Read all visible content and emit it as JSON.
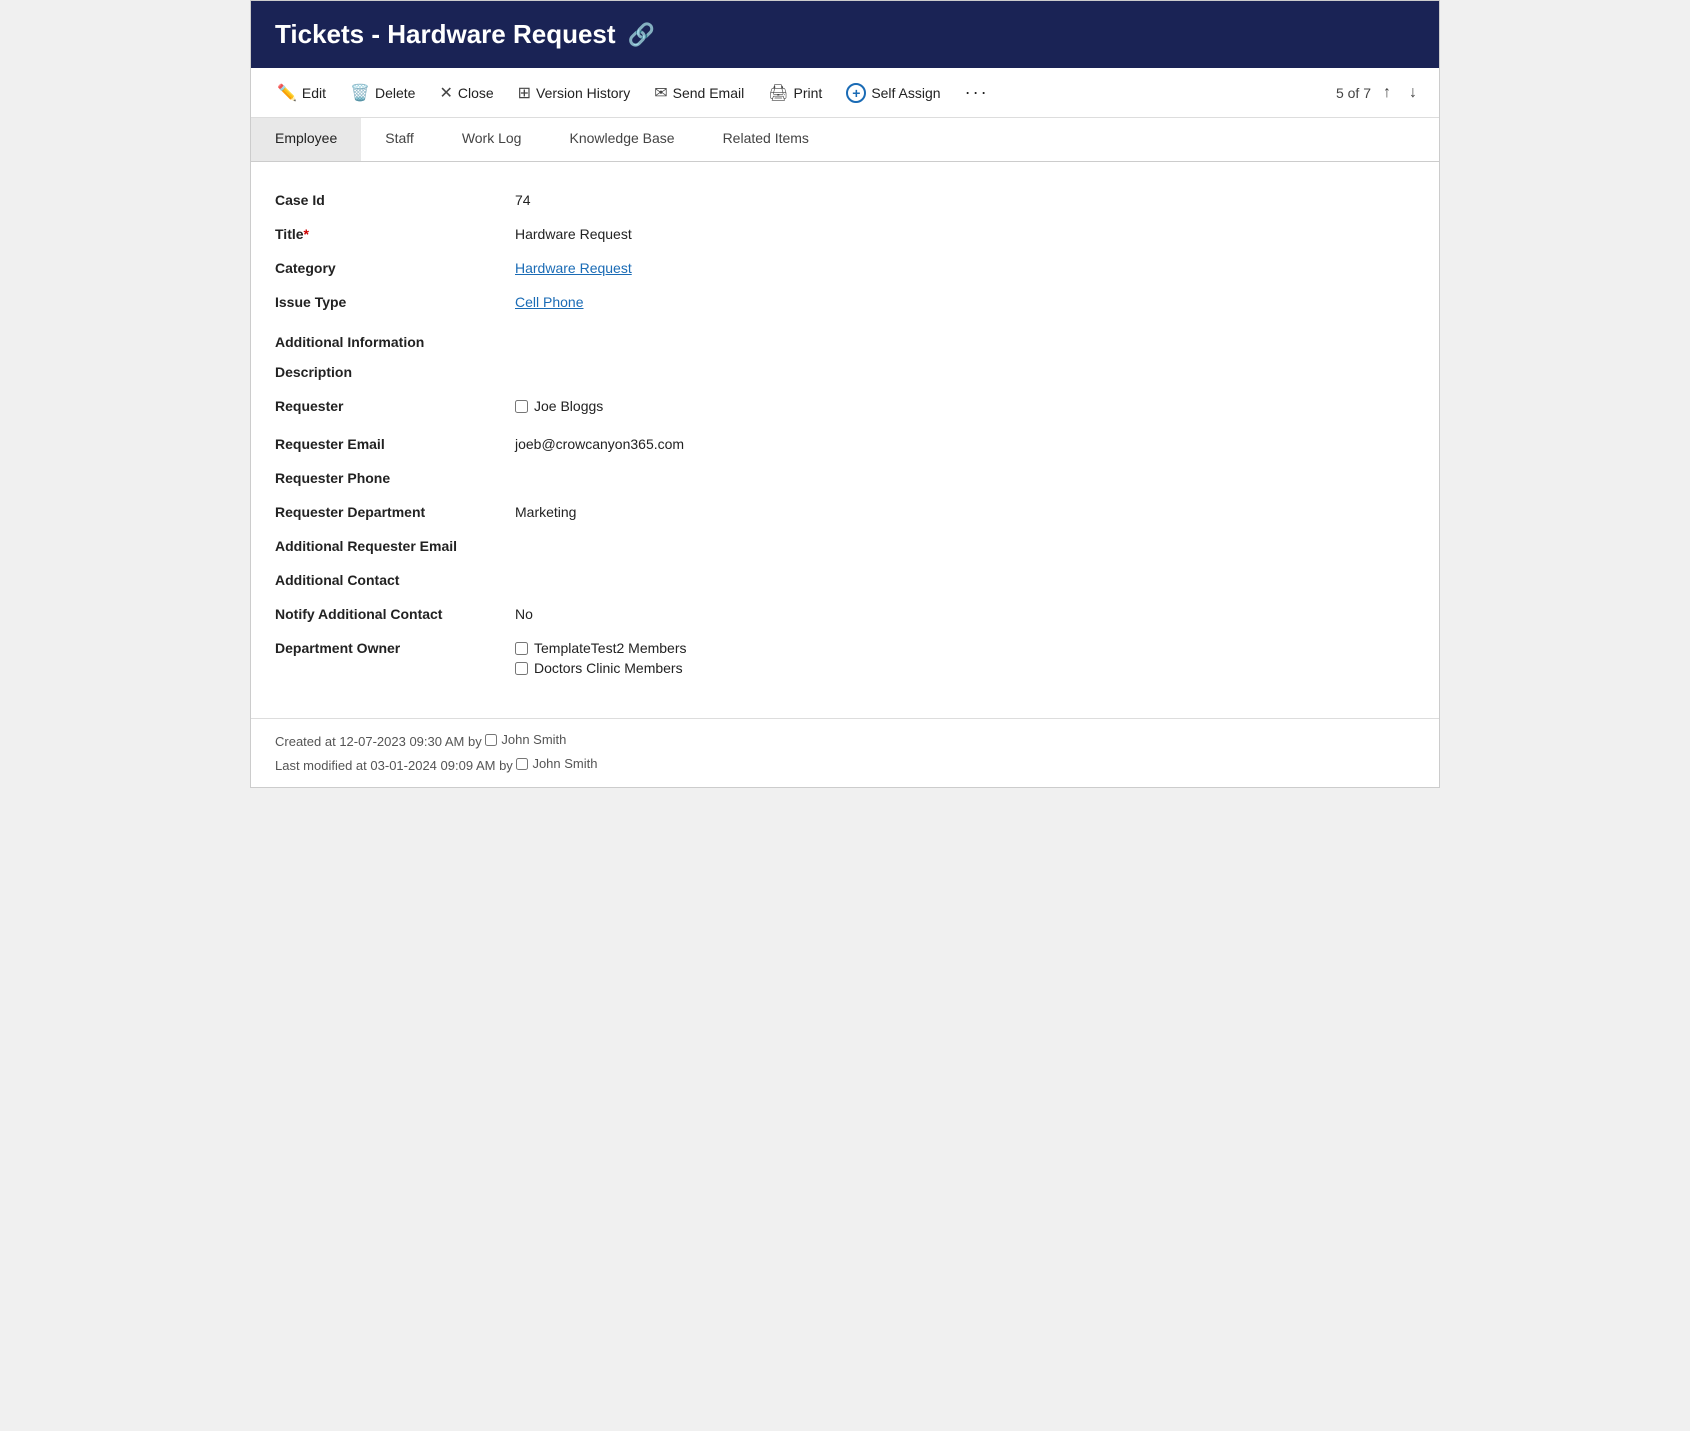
{
  "header": {
    "title": "Tickets - Hardware Request",
    "link_icon": "🔗"
  },
  "toolbar": {
    "edit_label": "Edit",
    "delete_label": "Delete",
    "close_label": "Close",
    "version_history_label": "Version History",
    "send_email_label": "Send Email",
    "print_label": "Print",
    "self_assign_label": "Self Assign",
    "more_label": "···",
    "pagination": "5 of 7"
  },
  "tabs": [
    {
      "id": "employee",
      "label": "Employee",
      "active": true
    },
    {
      "id": "staff",
      "label": "Staff",
      "active": false
    },
    {
      "id": "work-log",
      "label": "Work Log",
      "active": false
    },
    {
      "id": "knowledge-base",
      "label": "Knowledge Base",
      "active": false
    },
    {
      "id": "related-items",
      "label": "Related Items",
      "active": false
    }
  ],
  "fields": {
    "case_id_label": "Case Id",
    "case_id_value": "74",
    "title_label": "Title",
    "title_value": "Hardware Request",
    "category_label": "Category",
    "category_value": "Hardware Request",
    "issue_type_label": "Issue Type",
    "issue_type_value": "Cell Phone",
    "additional_information_label": "Additional Information",
    "description_label": "Description",
    "requester_label": "Requester",
    "requester_value": "Joe Bloggs",
    "requester_email_label": "Requester Email",
    "requester_email_value": "joeb@crowcanyon365.com",
    "requester_phone_label": "Requester Phone",
    "requester_phone_value": "",
    "requester_department_label": "Requester Department",
    "requester_department_value": "Marketing",
    "additional_requester_email_label": "Additional Requester Email",
    "additional_contact_label": "Additional Contact",
    "notify_additional_contact_label": "Notify Additional Contact",
    "notify_additional_contact_value": "No",
    "department_owner_label": "Department Owner",
    "department_owner_1": "TemplateTest2 Members",
    "department_owner_2": "Doctors Clinic Members"
  },
  "footer": {
    "created_label": "Created at",
    "created_date": "12-07-2023 09:30 AM",
    "created_by_prefix": "by",
    "created_by": "John Smith",
    "modified_label": "Last modified at",
    "modified_date": "03-01-2024 09:09 AM",
    "modified_by_prefix": "by",
    "modified_by": "John Smith"
  }
}
